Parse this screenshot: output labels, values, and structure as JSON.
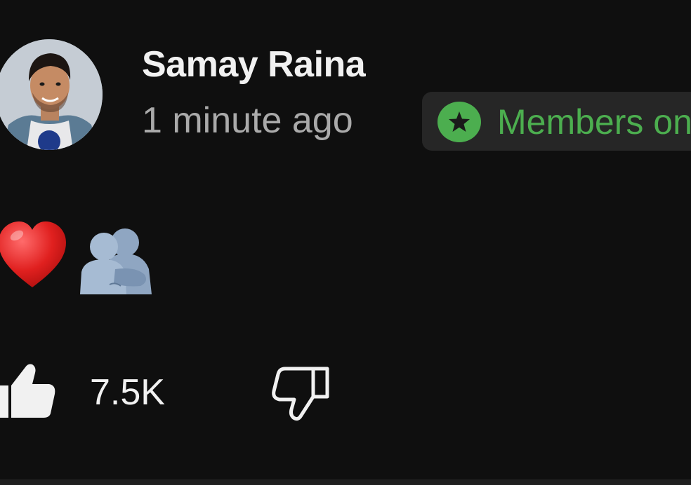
{
  "post": {
    "author": "Samay Raina",
    "timestamp": "1 minute ago",
    "badge": {
      "label": "Members only",
      "icon": "star-icon",
      "color": "#4cae4f"
    },
    "content": {
      "emojis": [
        "red-heart-emoji",
        "people-hugging-emoji"
      ]
    },
    "actions": {
      "like_count": "7.5K",
      "like_icon": "thumbs-up-icon",
      "dislike_icon": "thumbs-down-icon"
    }
  },
  "colors": {
    "background": "#0f0f0f",
    "primary_text": "#f1f1f1",
    "secondary_text": "#aaaaaa",
    "badge_background": "#262626",
    "badge_accent": "#4cae4f"
  }
}
